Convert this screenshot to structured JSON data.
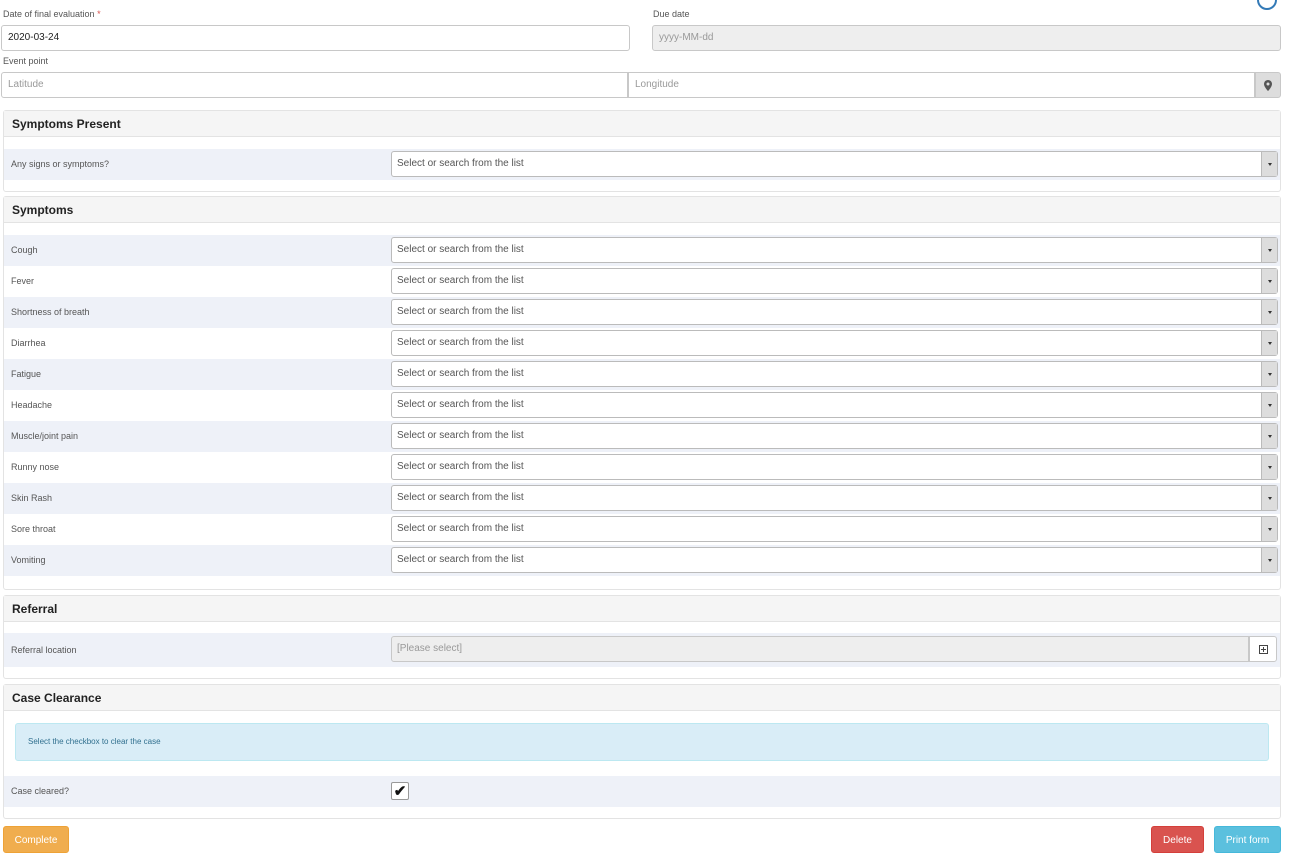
{
  "evaluation": {
    "date_label": "Date of final evaluation",
    "required_mark": "*",
    "date_value": "2020-03-24",
    "due_label": "Due date",
    "due_placeholder": "yyyy-MM-dd"
  },
  "event_point": {
    "label": "Event point",
    "latitude_placeholder": "Latitude",
    "longitude_placeholder": "Longitude",
    "location_icon": "map-marker-icon"
  },
  "symptoms_present": {
    "title": "Symptoms Present",
    "question": "Any signs or symptoms?",
    "value": "Select or search from the list"
  },
  "symptoms": {
    "title": "Symptoms",
    "items": [
      {
        "label": "Cough",
        "value": "Select or search from the list"
      },
      {
        "label": "Fever",
        "value": "Select or search from the list"
      },
      {
        "label": "Shortness of breath",
        "value": "Select or search from the list"
      },
      {
        "label": "Diarrhea",
        "value": "Select or search from the list"
      },
      {
        "label": "Fatigue",
        "value": "Select or search from the list"
      },
      {
        "label": "Headache",
        "value": "Select or search from the list"
      },
      {
        "label": "Muscle/joint pain",
        "value": "Select or search from the list"
      },
      {
        "label": "Runny nose",
        "value": "Select or search from the list"
      },
      {
        "label": "Skin Rash",
        "value": "Select or search from the list"
      },
      {
        "label": "Sore throat",
        "value": "Select or search from the list"
      },
      {
        "label": "Vomiting",
        "value": "Select or search from the list"
      }
    ]
  },
  "referral": {
    "title": "Referral",
    "location_label": "Referral location",
    "location_value": "[Please select]",
    "tree_icon": "plus-square-icon"
  },
  "clearance": {
    "title": "Case Clearance",
    "info": "Select the checkbox to clear the case",
    "checkbox_label": "Case cleared?",
    "checked": true
  },
  "actions": {
    "complete": "Complete",
    "delete": "Delete",
    "print": "Print form"
  },
  "colors": {
    "warning": "#f0ad4e",
    "danger": "#d9534f",
    "info": "#5bc0de",
    "row_shade": "#eef1f8"
  }
}
